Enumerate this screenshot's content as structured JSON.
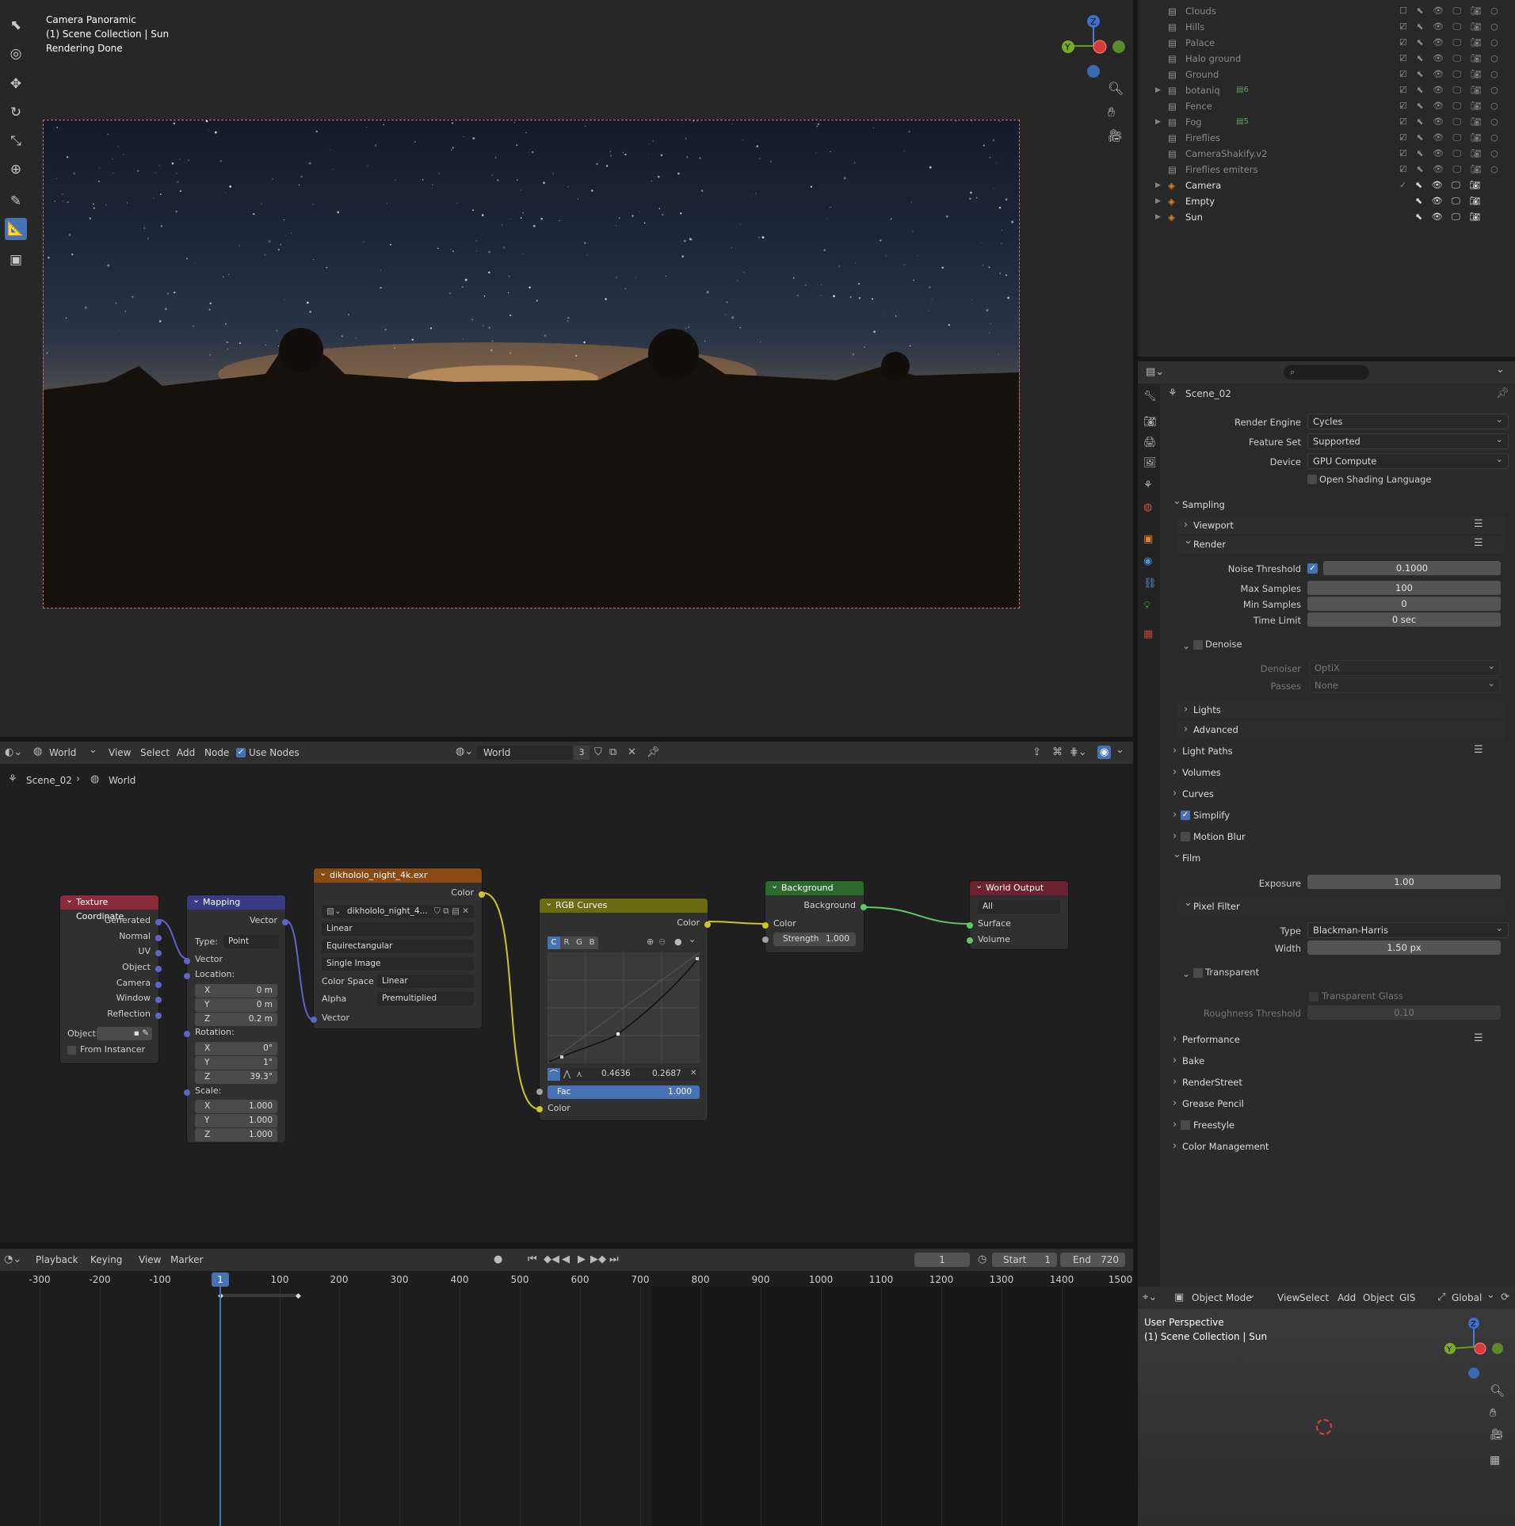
{
  "viewport": {
    "overlay": [
      "Camera Panoramic",
      "(1) Scene Collection | Sun",
      "Rendering Done"
    ]
  },
  "outliner": {
    "items": [
      {
        "name": "Clouds",
        "type": "collection"
      },
      {
        "name": "Hills",
        "type": "collection"
      },
      {
        "name": "Palace",
        "type": "collection"
      },
      {
        "name": "Halo ground",
        "type": "collection"
      },
      {
        "name": "Ground",
        "type": "collection"
      },
      {
        "name": "botaniq",
        "type": "collection",
        "badge": "6"
      },
      {
        "name": "Fence",
        "type": "collection"
      },
      {
        "name": "Fog",
        "type": "collection",
        "badge": "5"
      },
      {
        "name": "Fireflies",
        "type": "collection"
      },
      {
        "name": "CameraShakify.v2",
        "type": "collection"
      },
      {
        "name": "Fireflies emiters",
        "type": "collection"
      },
      {
        "name": "Camera",
        "type": "object"
      },
      {
        "name": "Empty",
        "type": "object"
      },
      {
        "name": "Sun",
        "type": "object"
      }
    ]
  },
  "properties": {
    "scene_name": "Scene_02",
    "render_engine_label": "Render Engine",
    "render_engine": "Cycles",
    "feature_set_label": "Feature Set",
    "feature_set": "Supported",
    "device_label": "Device",
    "device": "GPU Compute",
    "osl_label": "Open Shading Language",
    "sampling": "Sampling",
    "viewport": "Viewport",
    "render": "Render",
    "noise_threshold_label": "Noise Threshold",
    "noise_threshold": "0.1000",
    "max_samples_label": "Max Samples",
    "max_samples": "100",
    "min_samples_label": "Min Samples",
    "min_samples": "0",
    "time_limit_label": "Time Limit",
    "time_limit": "0 sec",
    "denoise": "Denoise",
    "denoiser_label": "Denoiser",
    "denoiser": "OptiX",
    "passes_label": "Passes",
    "passes": "None",
    "lights": "Lights",
    "advanced": "Advanced",
    "light_paths": "Light Paths",
    "volumes": "Volumes",
    "curves": "Curves",
    "simplify": "Simplify",
    "motion_blur": "Motion Blur",
    "film": "Film",
    "exposure_label": "Exposure",
    "exposure": "1.00",
    "pixel_filter": "Pixel Filter",
    "type_label": "Type",
    "type": "Blackman-Harris",
    "width_label": "Width",
    "width": "1.50 px",
    "transparent": "Transparent",
    "transparent_glass": "Transparent Glass",
    "roughness_label": "Roughness Threshold",
    "roughness": "0.10",
    "performance": "Performance",
    "bake": "Bake",
    "renderstreet": "RenderStreet",
    "grease_pencil": "Grease Pencil",
    "freestyle": "Freestyle",
    "color_management": "Color Management"
  },
  "node_editor": {
    "header": {
      "editor": "World",
      "menus": [
        "View",
        "Select",
        "Add",
        "Node"
      ],
      "use_nodes": "Use Nodes",
      "world_name": "World",
      "users": "3"
    },
    "breadcrumb": [
      "Scene_02",
      "World"
    ],
    "tex_coord": {
      "title": "Texture Coordinate",
      "outputs": [
        "Generated",
        "Normal",
        "UV",
        "Object",
        "Camera",
        "Window",
        "Reflection"
      ],
      "object_label": "Object:",
      "from_instancer": "From Instancer"
    },
    "mapping": {
      "title": "Mapping",
      "out": "Vector",
      "type_label": "Type:",
      "type": "Point",
      "vector": "Vector",
      "location": "Location:",
      "loc": [
        [
          "X",
          "0 m"
        ],
        [
          "Y",
          "0 m"
        ],
        [
          "Z",
          "0.2 m"
        ]
      ],
      "rotation": "Rotation:",
      "rot": [
        [
          "X",
          "0°"
        ],
        [
          "Y",
          "1°"
        ],
        [
          "Z",
          "39.3°"
        ]
      ],
      "scale": "Scale:",
      "scl": [
        [
          "X",
          "1.000"
        ],
        [
          "Y",
          "1.000"
        ],
        [
          "Z",
          "1.000"
        ]
      ]
    },
    "env": {
      "title": "dikhololo_night_4k.exr",
      "out": "Color",
      "image": "dikhololo_night_4...",
      "interp": "Linear",
      "proj": "Equirectangular",
      "src": "Single Image",
      "cs_label": "Color Space",
      "cs": "Linear",
      "alpha_label": "Alpha",
      "alpha": "Premultiplied",
      "vector": "Vector"
    },
    "curves": {
      "title": "RGB Curves",
      "out": "Color",
      "channels": [
        "C",
        "R",
        "G",
        "B"
      ],
      "px": "0.4636",
      "py": "0.2687",
      "fac_label": "Fac",
      "fac": "1.000",
      "color": "Color"
    },
    "background": {
      "title": "Background",
      "out": "Background",
      "color": "Color",
      "strength_label": "Strength",
      "strength": "1.000"
    },
    "output": {
      "title": "World Output",
      "target": "All",
      "surface": "Surface",
      "volume": "Volume"
    }
  },
  "timeline": {
    "menus": [
      "Playback",
      "Keying",
      "View",
      "Marker"
    ],
    "current": "1",
    "start_label": "Start",
    "start": "1",
    "end_label": "End",
    "end": "720",
    "ticks": [
      "-300",
      "-200",
      "-100",
      "100",
      "200",
      "300",
      "400",
      "500",
      "600",
      "700",
      "800",
      "900",
      "1000",
      "1100",
      "1200",
      "1300",
      "1400",
      "1500"
    ],
    "cursor": "1"
  },
  "viewport2": {
    "mode": "Object Mode",
    "menus": [
      "View",
      "Select",
      "Add",
      "Object",
      "GIS"
    ],
    "orient": "Global",
    "overlay": [
      "User Perspective",
      "(1) Scene Collection | Sun"
    ]
  },
  "colors": {
    "tex": "#8a2b3b",
    "mapping": "#3b3b85",
    "image": "#8a4a14",
    "curves": "#6b6b14",
    "bg": "#2d6a2d",
    "out": "#6b2333",
    "accent": "#4772b3"
  }
}
